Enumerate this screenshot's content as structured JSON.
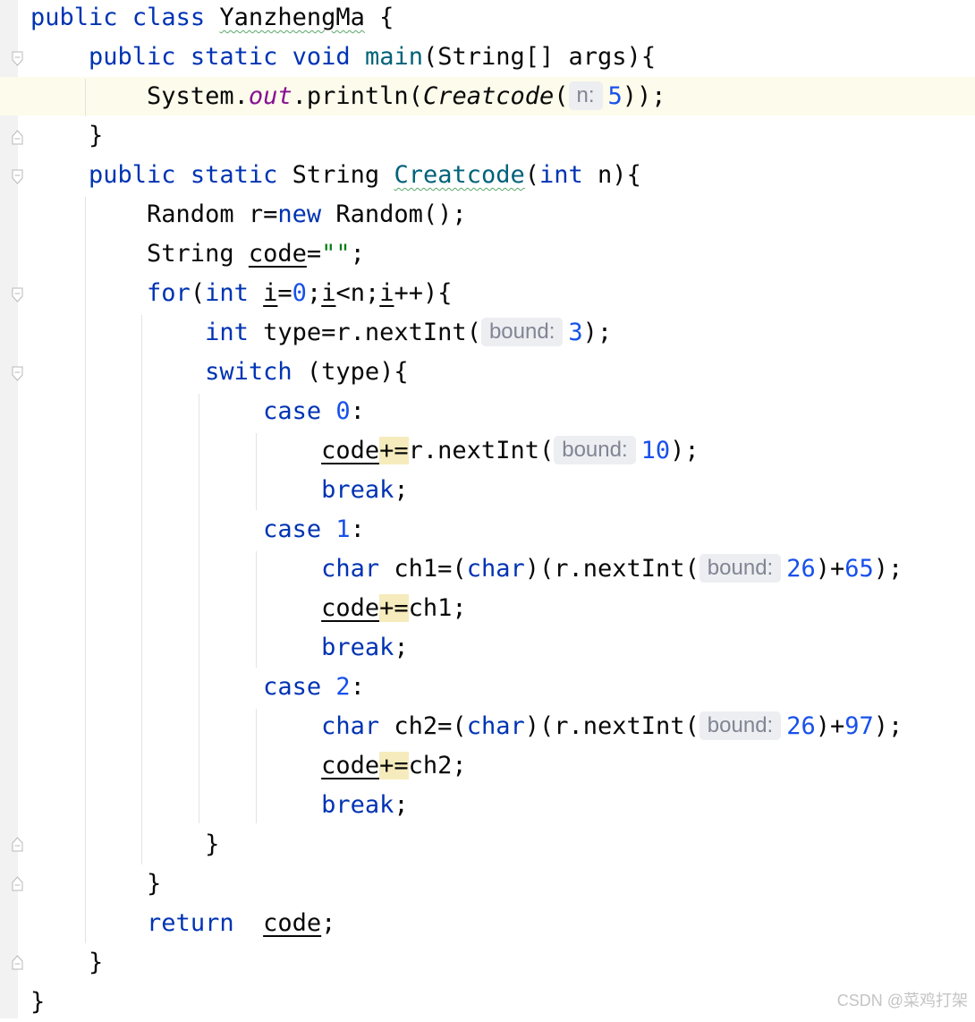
{
  "editor": {
    "lines": [
      {
        "tokens": [
          [
            "kw",
            "public"
          ],
          [
            "t",
            " "
          ],
          [
            "kw",
            "class"
          ],
          [
            "t",
            " "
          ],
          [
            "sq",
            "YanzhengMa"
          ],
          [
            "t",
            " {"
          ]
        ]
      },
      {
        "tokens": [
          [
            "t",
            "    "
          ],
          [
            "kw",
            "public"
          ],
          [
            "t",
            " "
          ],
          [
            "kw",
            "static"
          ],
          [
            "t",
            " "
          ],
          [
            "kw",
            "void"
          ],
          [
            "t",
            " "
          ],
          [
            "fn",
            "main"
          ],
          [
            "t",
            "(String[] args){"
          ]
        ]
      },
      {
        "tokens": [
          [
            "t",
            "        System."
          ],
          [
            "sf",
            "out"
          ],
          [
            "t",
            ".println("
          ],
          [
            "it",
            "Creatcode"
          ],
          [
            "t",
            "("
          ],
          [
            "hint",
            "n:"
          ],
          [
            "num",
            "5"
          ],
          [
            "t",
            "));"
          ]
        ]
      },
      {
        "tokens": [
          [
            "t",
            "    }"
          ]
        ]
      },
      {
        "tokens": [
          [
            "t",
            "    "
          ],
          [
            "kw",
            "public"
          ],
          [
            "t",
            " "
          ],
          [
            "kw",
            "static"
          ],
          [
            "t",
            " String "
          ],
          [
            "fnsq",
            "Creatcode"
          ],
          [
            "t",
            "("
          ],
          [
            "kw",
            "int"
          ],
          [
            "t",
            " n){"
          ]
        ]
      },
      {
        "tokens": [
          [
            "t",
            "        Random r="
          ],
          [
            "kw",
            "new"
          ],
          [
            "t",
            " Random();"
          ]
        ]
      },
      {
        "tokens": [
          [
            "t",
            "        String "
          ],
          [
            "ul",
            "code"
          ],
          [
            "t",
            "="
          ],
          [
            "str",
            "\"\""
          ],
          [
            "t",
            ";"
          ]
        ]
      },
      {
        "tokens": [
          [
            "t",
            "        "
          ],
          [
            "kw",
            "for"
          ],
          [
            "t",
            "("
          ],
          [
            "kw",
            "int"
          ],
          [
            "t",
            " "
          ],
          [
            "ul",
            "i"
          ],
          [
            "t",
            "="
          ],
          [
            "num",
            "0"
          ],
          [
            "t",
            ";"
          ],
          [
            "ul",
            "i"
          ],
          [
            "t",
            "<n;"
          ],
          [
            "ul",
            "i"
          ],
          [
            "t",
            "++){"
          ]
        ]
      },
      {
        "tokens": [
          [
            "t",
            "            "
          ],
          [
            "kw",
            "int"
          ],
          [
            "t",
            " type=r.nextInt("
          ],
          [
            "hint",
            "bound:"
          ],
          [
            "num",
            "3"
          ],
          [
            "t",
            ");"
          ]
        ]
      },
      {
        "tokens": [
          [
            "t",
            "            "
          ],
          [
            "kw",
            "switch"
          ],
          [
            "t",
            " (type){"
          ]
        ]
      },
      {
        "tokens": [
          [
            "t",
            "                "
          ],
          [
            "kw",
            "case"
          ],
          [
            "t",
            " "
          ],
          [
            "num",
            "0"
          ],
          [
            "t",
            ":"
          ]
        ]
      },
      {
        "tokens": [
          [
            "t",
            "                    "
          ],
          [
            "ul",
            "code"
          ],
          [
            "hl",
            "+="
          ],
          [
            "t",
            "r.nextInt("
          ],
          [
            "hint",
            "bound:"
          ],
          [
            "num",
            "10"
          ],
          [
            "t",
            ");"
          ]
        ]
      },
      {
        "tokens": [
          [
            "t",
            "                    "
          ],
          [
            "kw",
            "break"
          ],
          [
            "t",
            ";"
          ]
        ]
      },
      {
        "tokens": [
          [
            "t",
            "                "
          ],
          [
            "kw",
            "case"
          ],
          [
            "t",
            " "
          ],
          [
            "num",
            "1"
          ],
          [
            "t",
            ":"
          ]
        ]
      },
      {
        "tokens": [
          [
            "t",
            "                    "
          ],
          [
            "kw",
            "char"
          ],
          [
            "t",
            " ch1=("
          ],
          [
            "kw",
            "char"
          ],
          [
            "t",
            ")(r.nextInt("
          ],
          [
            "hint",
            "bound:"
          ],
          [
            "num",
            "26"
          ],
          [
            "t",
            ")+"
          ],
          [
            "num",
            "65"
          ],
          [
            "t",
            ");"
          ]
        ]
      },
      {
        "tokens": [
          [
            "t",
            "                    "
          ],
          [
            "ul",
            "code"
          ],
          [
            "hl",
            "+="
          ],
          [
            "t",
            "ch1;"
          ]
        ]
      },
      {
        "tokens": [
          [
            "t",
            "                    "
          ],
          [
            "kw",
            "break"
          ],
          [
            "t",
            ";"
          ]
        ]
      },
      {
        "tokens": [
          [
            "t",
            "                "
          ],
          [
            "kw",
            "case"
          ],
          [
            "t",
            " "
          ],
          [
            "num",
            "2"
          ],
          [
            "t",
            ":"
          ]
        ]
      },
      {
        "tokens": [
          [
            "t",
            "                    "
          ],
          [
            "kw",
            "char"
          ],
          [
            "t",
            " ch2=("
          ],
          [
            "kw",
            "char"
          ],
          [
            "t",
            ")(r.nextInt("
          ],
          [
            "hint",
            "bound:"
          ],
          [
            "num",
            "26"
          ],
          [
            "t",
            ")+"
          ],
          [
            "num",
            "97"
          ],
          [
            "t",
            ");"
          ]
        ]
      },
      {
        "tokens": [
          [
            "t",
            "                    "
          ],
          [
            "ul",
            "code"
          ],
          [
            "hl",
            "+="
          ],
          [
            "t",
            "ch2;"
          ]
        ]
      },
      {
        "tokens": [
          [
            "t",
            "                    "
          ],
          [
            "kw",
            "break"
          ],
          [
            "t",
            ";"
          ]
        ]
      },
      {
        "tokens": [
          [
            "t",
            "            }"
          ]
        ]
      },
      {
        "tokens": [
          [
            "t",
            "        }"
          ]
        ]
      },
      {
        "tokens": [
          [
            "t",
            "        "
          ],
          [
            "kw",
            "return"
          ],
          [
            "t",
            "  "
          ],
          [
            "ul",
            "code"
          ],
          [
            "t",
            ";"
          ]
        ]
      },
      {
        "tokens": [
          [
            "t",
            "    }"
          ]
        ]
      },
      {
        "tokens": [
          [
            "t",
            "}"
          ]
        ]
      }
    ]
  },
  "watermark": "CSDN @菜鸡打架"
}
